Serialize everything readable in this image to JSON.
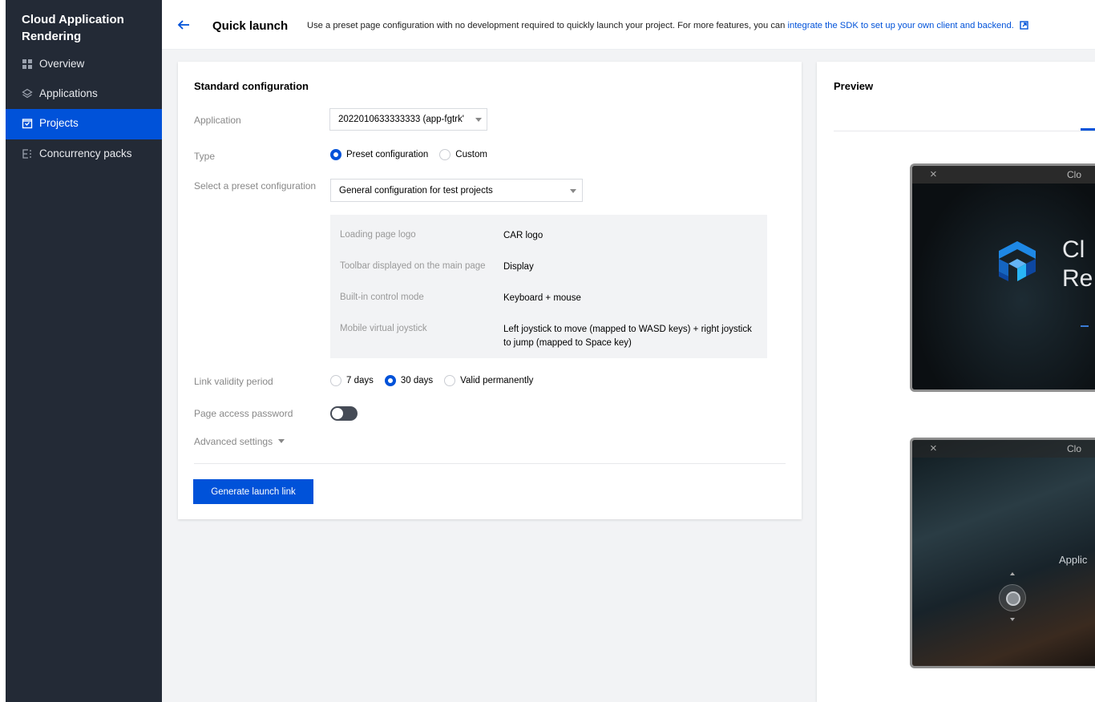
{
  "sidebar": {
    "brand": "Cloud Application Rendering",
    "items": [
      {
        "label": "Overview",
        "icon": "grid-icon",
        "active": false
      },
      {
        "label": "Applications",
        "icon": "layers-icon",
        "active": false
      },
      {
        "label": "Projects",
        "icon": "project-icon",
        "active": true
      },
      {
        "label": "Concurrency packs",
        "icon": "concurrency-icon",
        "active": false
      }
    ]
  },
  "header": {
    "title": "Quick launch",
    "description": "Use a preset page configuration with no development required to quickly launch your project. For more features, you can",
    "link_text": "integrate the SDK to set up your own client and backend."
  },
  "config": {
    "title": "Standard configuration",
    "application_label": "Application",
    "application_value": "2022010633333333 (app-fgtrk'",
    "type_label": "Type",
    "type_options": [
      "Preset configuration",
      "Custom"
    ],
    "type_selected": "Preset configuration",
    "preset_label": "Select a preset configuration",
    "preset_value": "General configuration for test projects",
    "preset_details": [
      {
        "key": "Loading page logo",
        "value": "CAR logo"
      },
      {
        "key": "Toolbar displayed on the main page",
        "value": "Display"
      },
      {
        "key": "Built-in control mode",
        "value": "Keyboard + mouse"
      },
      {
        "key": "Mobile virtual joystick",
        "value": "Left joystick to move (mapped to WASD keys) + right joystick to jump (mapped to Space key)"
      }
    ],
    "validity_label": "Link validity period",
    "validity_options": [
      "7 days",
      "30 days",
      "Valid permanently"
    ],
    "validity_selected": "30 days",
    "password_label": "Page access password",
    "password_enabled": false,
    "advanced_label": "Advanced settings",
    "generate_button": "Generate launch link"
  },
  "preview": {
    "title": "Preview",
    "frame1_title": "Clo",
    "frame1_text_line1": "Cl",
    "frame1_text_line2": "Re",
    "frame2_title": "Clo",
    "frame2_text": "Applic"
  },
  "colors": {
    "accent": "#0052d9",
    "sidebar_bg": "#232a36"
  }
}
